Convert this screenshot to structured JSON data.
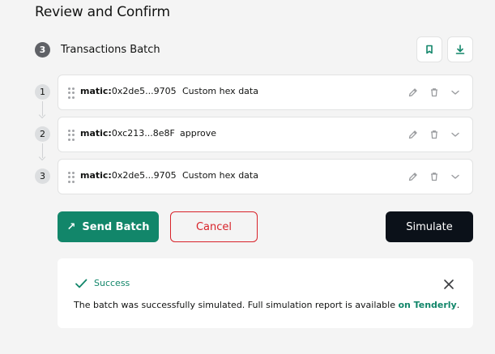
{
  "page": {
    "title": "Review and Confirm"
  },
  "batch": {
    "step_number": "3",
    "title": "Transactions Batch",
    "bookmark_icon": "bookmark-icon",
    "download_icon": "download-icon"
  },
  "transactions": [
    {
      "index": "1",
      "chain": "matic:",
      "address": "0x2de5...9705",
      "method": "Custom hex data"
    },
    {
      "index": "2",
      "chain": "matic:",
      "address": "0xc213...8e8F",
      "method": "approve"
    },
    {
      "index": "3",
      "chain": "matic:",
      "address": "0x2de5...9705",
      "method": "Custom hex data"
    }
  ],
  "actions": {
    "send_batch": "Send Batch",
    "cancel": "Cancel",
    "simulate": "Simulate"
  },
  "result": {
    "status": "Success",
    "message_prefix": "The batch was successfully simulated. Full simulation report is available ",
    "link_text": "on Tenderly",
    "message_suffix": "."
  },
  "colors": {
    "accent_green": "#12866a",
    "danger_red": "#d8232a",
    "dark_button": "#0b1119"
  }
}
